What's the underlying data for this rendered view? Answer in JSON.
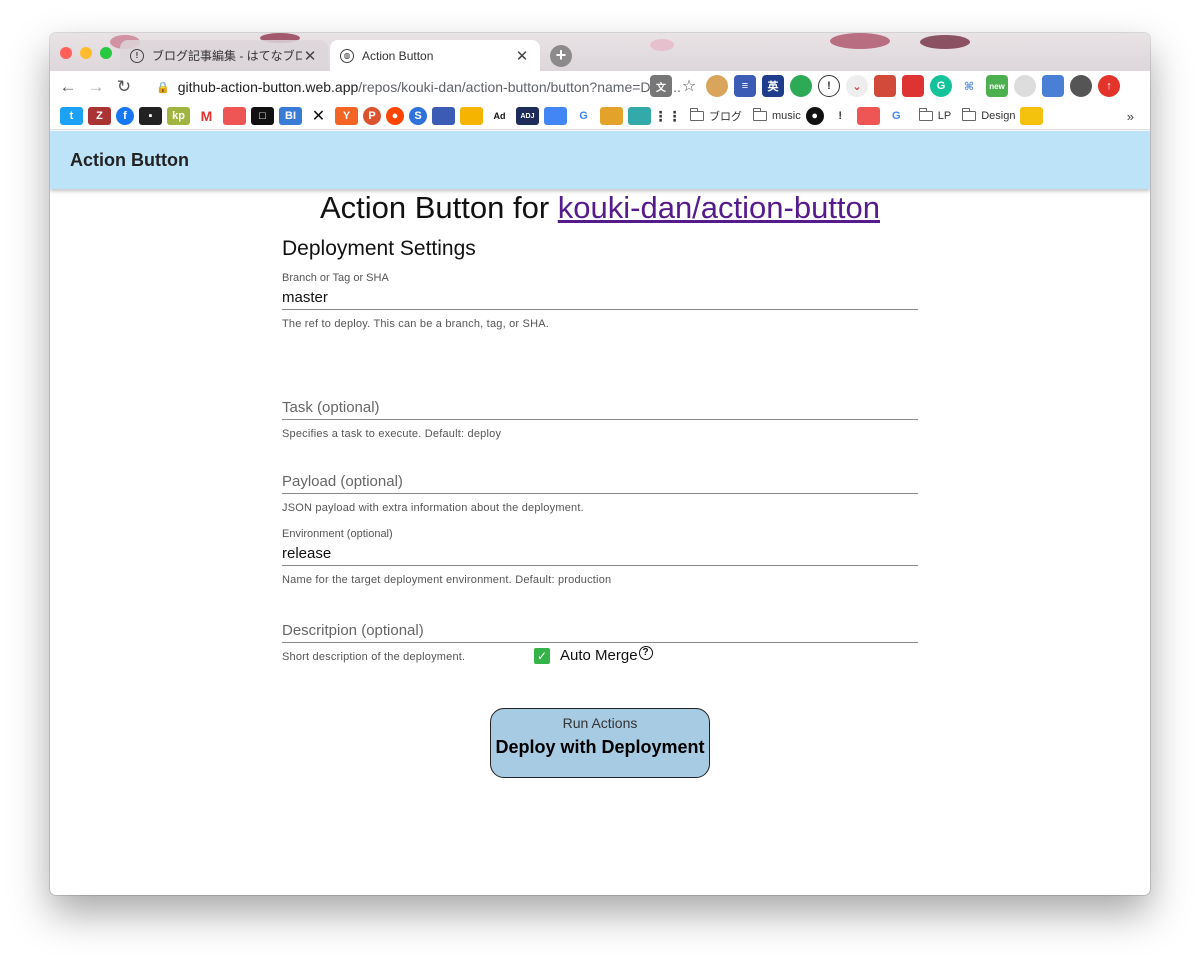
{
  "browser": {
    "tabs": [
      {
        "title": "ブログ記事編集 - はてなブログ",
        "active": false
      },
      {
        "title": "Action Button",
        "active": true
      }
    ],
    "url": {
      "host": "github-action-button.web.app",
      "path": "/repos/kouki-dan/action-button/button?name=Depl..."
    },
    "bookmarks": {
      "folders": [
        "ブログ",
        "music",
        "LP",
        "Design"
      ],
      "overflow": "»"
    },
    "extensions": {
      "badge_new": "new"
    }
  },
  "header": {
    "title": "Action Button"
  },
  "main": {
    "heading_prefix": "Action Button for ",
    "repo_link": "kouki-dan/action-button",
    "section_title": "Deployment Settings",
    "fields": {
      "ref": {
        "label": "Branch or Tag or SHA",
        "value": "master",
        "help": "The ref to deploy. This can be a branch, tag, or SHA."
      },
      "task": {
        "placeholder": "Task (optional)",
        "help": "Specifies a task to execute. Default: deploy"
      },
      "payload": {
        "placeholder": "Payload (optional)",
        "help": "JSON payload with extra information about the deployment."
      },
      "environment": {
        "label": "Environment (optional)",
        "value": "release",
        "help": "Name for the target deployment environment. Default: production"
      },
      "description": {
        "placeholder": "Descritpion (optional)",
        "help": "Short description of the deployment."
      }
    },
    "auto_merge": {
      "label": "Auto Merge",
      "checked": true
    },
    "run_button": {
      "subtitle": "Run Actions",
      "title": "Deploy with Deployment"
    }
  },
  "colors": {
    "header_bg": "#bde3f8",
    "button_bg": "#a6cbe3",
    "checkbox": "#36b24b",
    "link": "#551a8b"
  }
}
